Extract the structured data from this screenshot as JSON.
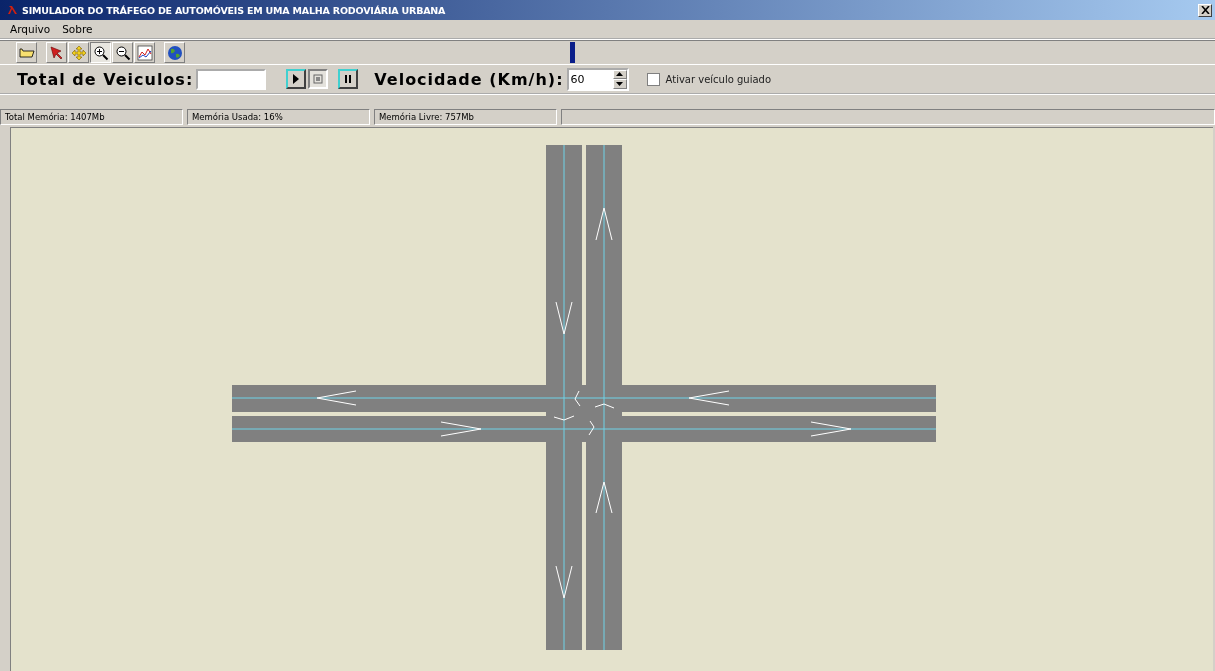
{
  "window": {
    "title": "SIMULADOR DO TRÁFEGO DE AUTOMÓVEIS EM UMA MALHA RODOVIÁRIA URBANA"
  },
  "menu": [
    "Arquivo",
    "Sobre"
  ],
  "toolbar": [
    {
      "kind": "open",
      "selected": false
    },
    {
      "kind": "select",
      "selected": false
    },
    {
      "kind": "move",
      "selected": false
    },
    {
      "kind": "zoom-in",
      "selected": true
    },
    {
      "kind": "zoom-out",
      "selected": false
    },
    {
      "kind": "chart",
      "selected": false
    },
    {
      "kind": "globe",
      "selected": false
    }
  ],
  "controls": {
    "vehicles_label": "Total de Veiculos:",
    "playback": [
      {
        "kind": "play",
        "selected": false
      },
      {
        "kind": "stop",
        "selected": true
      },
      {
        "kind": "pause",
        "selected": false
      }
    ],
    "speed_label": "Velocidade (Km/h):",
    "speed_value": "60",
    "guided": {
      "label": "Ativar veículo guiado",
      "checked": false
    }
  },
  "status_bar": [
    "Total Memória: 1407Mb",
    "Memória Usada: 16%",
    "Memória Livre:  757Mb"
  ]
}
